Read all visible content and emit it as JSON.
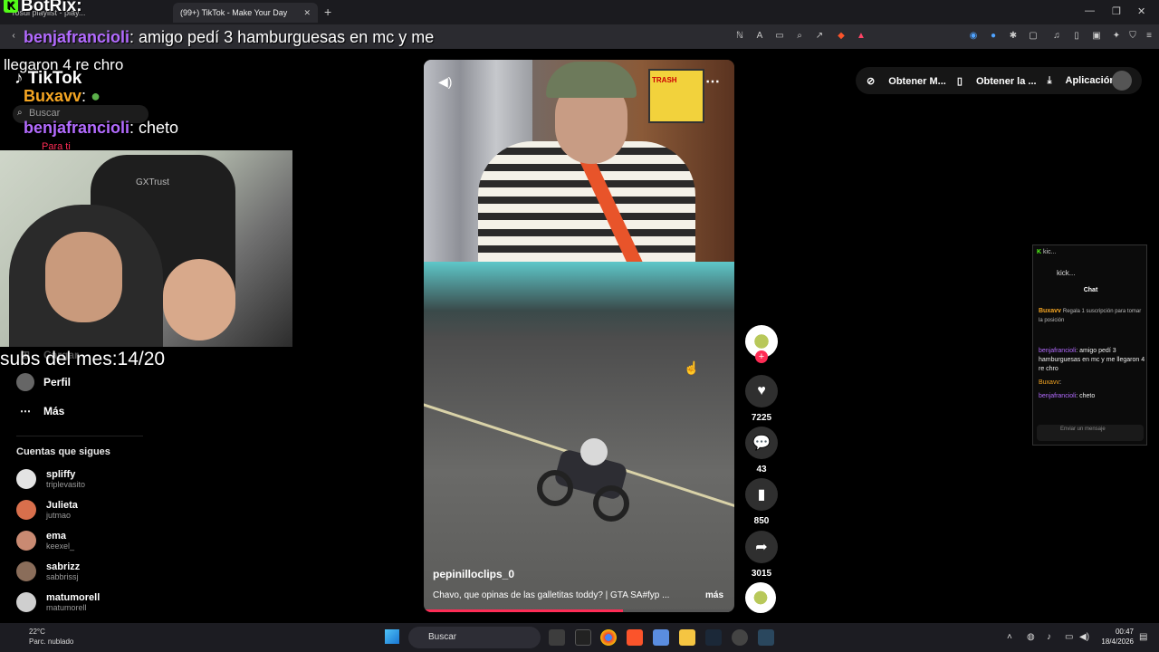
{
  "browser": {
    "tabs": [
      {
        "label": "Tosui playlist - play..."
      },
      {
        "label": "(99+) TikTok - Make Your Day"
      }
    ],
    "new_tab": "+",
    "win_min": "—",
    "win_max": "❐",
    "win_close": "✕",
    "address": ""
  },
  "overlay": {
    "botrix": "BotRix:",
    "chat": [
      {
        "user": "benjafrancioli",
        "text": ": amigo pedí 3 hamburguesas en mc y me"
      },
      {
        "user": "",
        "text": "llegaron 4 re chro"
      },
      {
        "user": "Buxavv",
        "text": ":"
      },
      {
        "user": "benjafrancioli",
        "text": ": cheto"
      }
    ],
    "subs": "subs del mes:14/20"
  },
  "tiktok": {
    "logo": "TikTok",
    "search_placeholder": "Buscar",
    "para_ti": "Para ti",
    "nav": [
      {
        "label": "Cargar"
      },
      {
        "label": "Perfil"
      },
      {
        "label": "Más"
      }
    ],
    "following_title": "Cuentas que sigues",
    "following": [
      {
        "name": "spliffy",
        "handle": "triplevasito",
        "color": "#e3e3e3"
      },
      {
        "name": "Julieta",
        "handle": "jutmao",
        "color": "#d86f4c"
      },
      {
        "name": "ema",
        "handle": "keexel_",
        "color": "#c98a72"
      },
      {
        "name": "sabrizz",
        "handle": "sabbrissj",
        "color": "#8a6d5a"
      },
      {
        "name": "matumorell",
        "handle": "matumorell",
        "color": "#cfcfcf"
      }
    ],
    "top_actions": [
      {
        "label": "Obtener M..."
      },
      {
        "label": "Obtener la ..."
      },
      {
        "label": "Aplicación ..."
      }
    ],
    "video": {
      "username": "pepinilloclips_0",
      "description": "Chavo, que opinas de las galletitas toddy? | GTA SA#fyp ...",
      "more": "más",
      "progress": 0.64,
      "poster_text": "TRASH"
    },
    "actions": [
      {
        "icon": "heart-icon",
        "count": "7225"
      },
      {
        "icon": "comment-icon",
        "count": "43"
      },
      {
        "icon": "bookmark-icon",
        "count": "850"
      },
      {
        "icon": "share-icon",
        "count": "3015"
      }
    ],
    "accent": "#fe2c55"
  },
  "kick": {
    "title": "kic...",
    "url": "kick...",
    "chat_label": "Chat",
    "gift": "Regala 1 suscripción para tomar la posición",
    "gift_user": "Buxavv",
    "lines": [
      {
        "user": "benjafrancioli",
        "text": ": amigo pedí 3 hamburguesas en mc y me llegaron 4 re chro"
      },
      {
        "user": "Buxavv",
        "text": ":"
      },
      {
        "user": "benjafrancioli",
        "text": ": cheto"
      }
    ],
    "input_placeholder": "Enviar un mensaje"
  },
  "taskbar": {
    "temp": "22°C",
    "weather": "Parc. nublado",
    "search": "Buscar",
    "time": "00:47",
    "date": "18/4/2026"
  }
}
